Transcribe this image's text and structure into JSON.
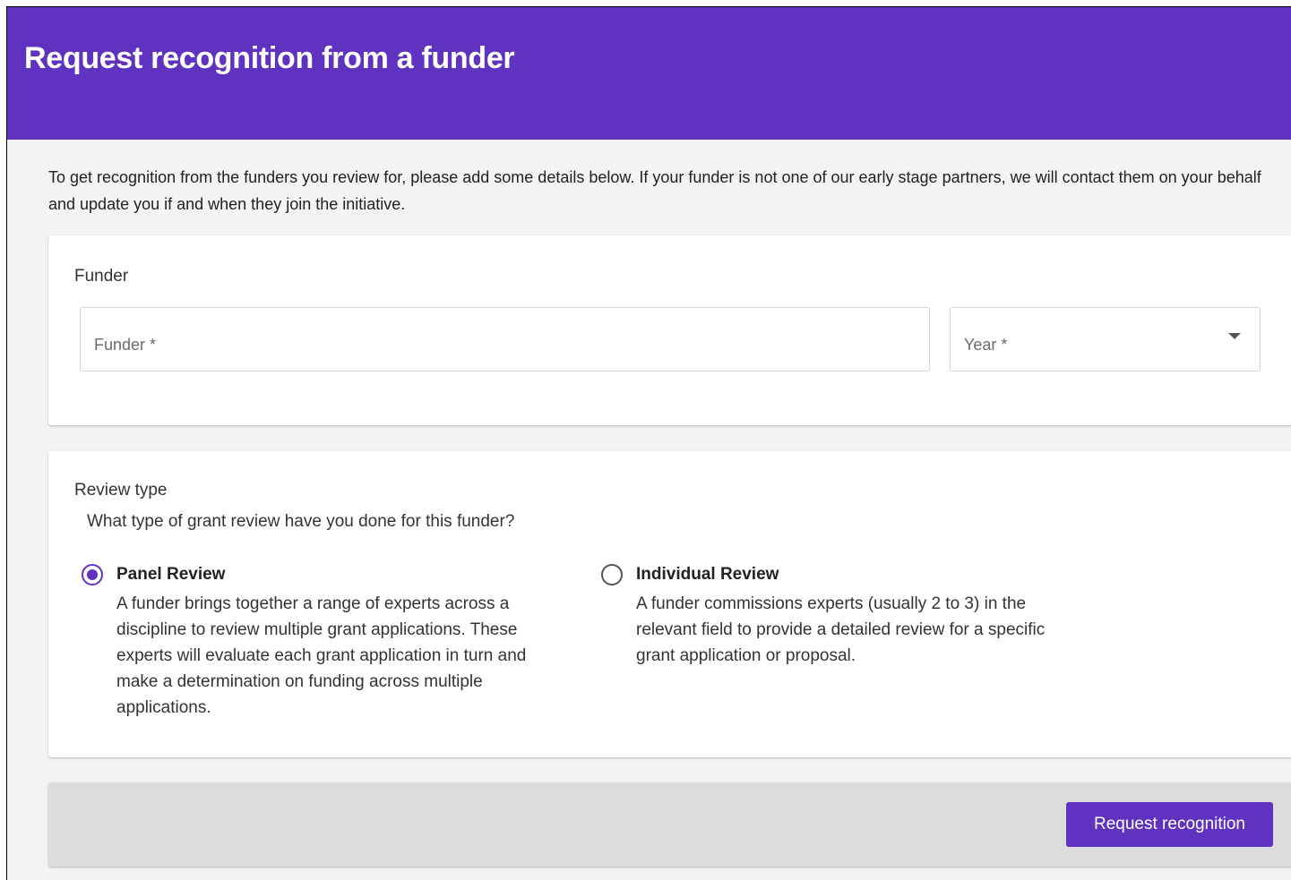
{
  "header": {
    "title": "Request recognition from a funder"
  },
  "intro": {
    "text": "To get recognition from the funders you review for, please add some details below. If your funder is not one of our early stage partners, we will contact them on your behalf and update you if and when they join the initiative."
  },
  "funder_section": {
    "label": "Funder",
    "funder_field": {
      "placeholder": "Funder *",
      "value": ""
    },
    "year_field": {
      "placeholder": "Year *",
      "value": ""
    }
  },
  "review_section": {
    "label": "Review type",
    "question": "What type of grant review have you done for this funder?",
    "options": [
      {
        "title": "Panel Review",
        "description": "A funder brings together a range of experts across a discipline to review multiple grant applications. These experts will evaluate each grant application in turn and make a determination on funding across multiple applications.",
        "selected": true
      },
      {
        "title": "Individual Review",
        "description": "A funder commissions experts (usually 2 to 3) in the relevant field to provide a detailed review for a specific grant application or proposal.",
        "selected": false
      }
    ]
  },
  "footer": {
    "submit_label": "Request recognition"
  },
  "colors": {
    "brand": "#5f33bf",
    "page_background": "#f3f3f3",
    "footer_background": "#dcdcdc"
  },
  "icons": {
    "year_dropdown": "caret-down-icon",
    "option_selected": "radio-checked-icon",
    "option_unselected": "radio-unchecked-icon"
  }
}
